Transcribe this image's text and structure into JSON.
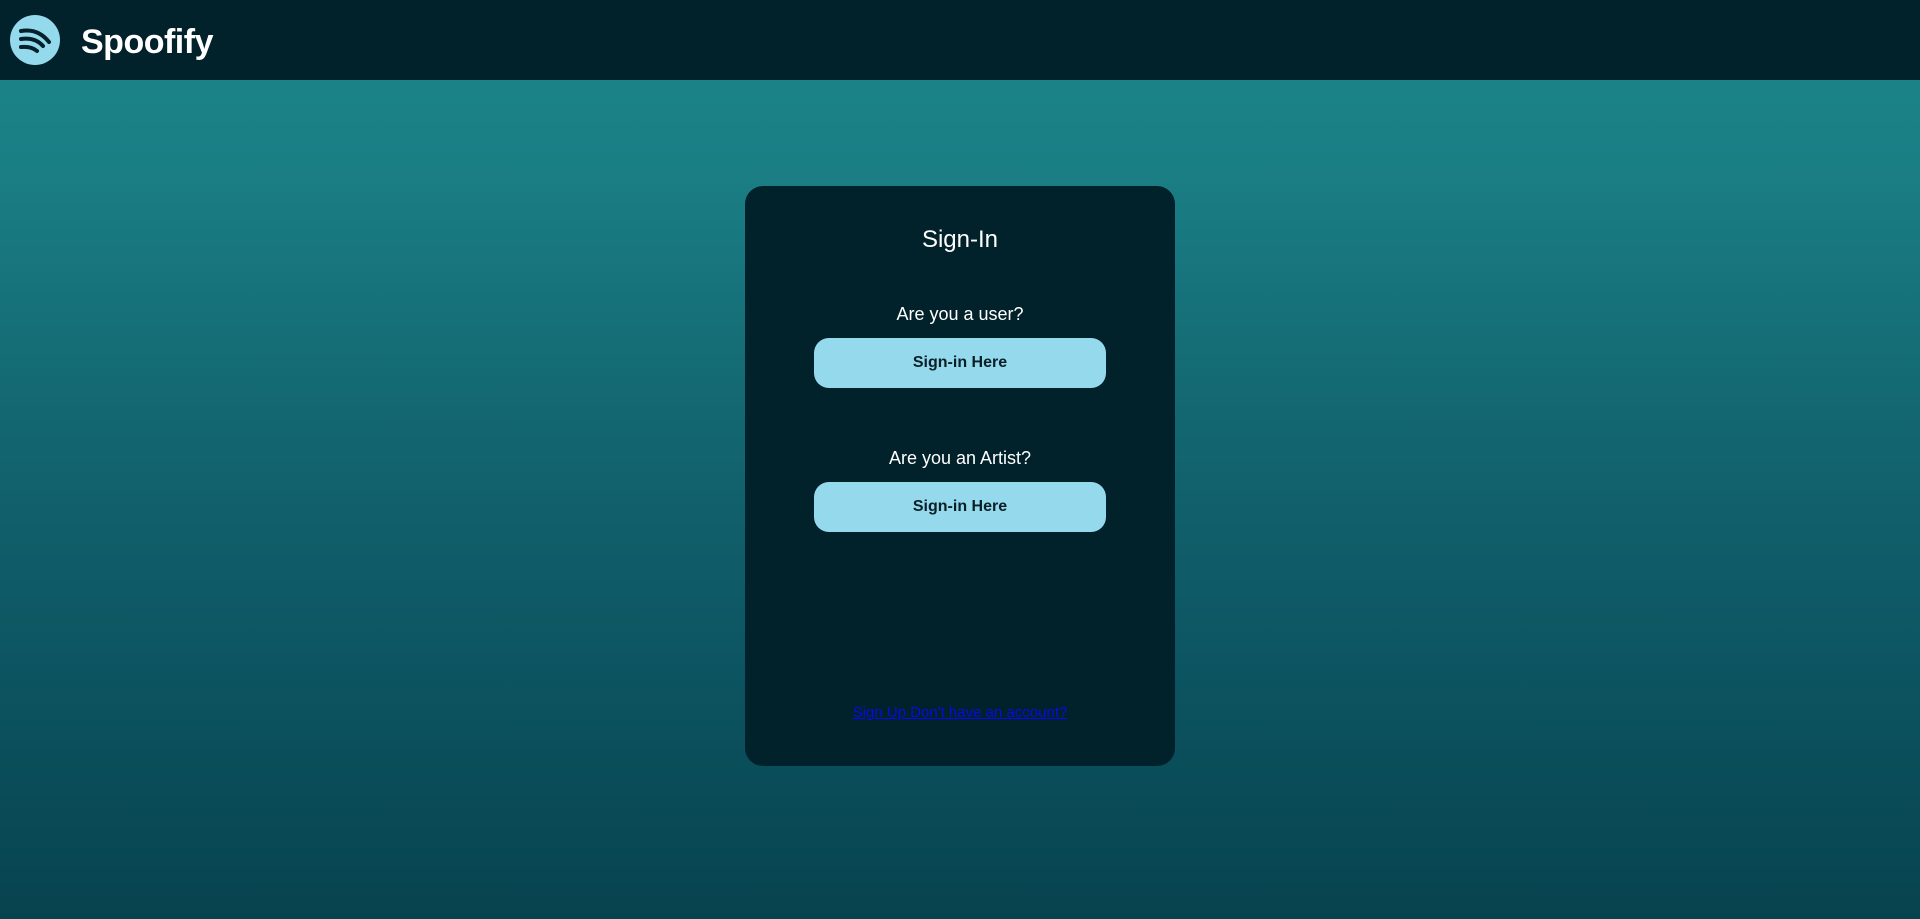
{
  "header": {
    "brand": "Spoofify",
    "logo_icon": "spoofify-logo-icon"
  },
  "signin_card": {
    "title": "Sign-In",
    "user_prompt": "Are you a user?",
    "user_button_label": "Sign-in Here",
    "artist_prompt": "Are you an Artist?",
    "artist_button_label": "Sign-in Here",
    "signup_link": "Sign Up Don't have an account?"
  },
  "colors": {
    "navbar": "#01212b",
    "card": "#01212b",
    "button": "#95d9ec",
    "link": "#0a0ae6",
    "background_top": "#1c878c",
    "background_bottom": "#07434f"
  }
}
